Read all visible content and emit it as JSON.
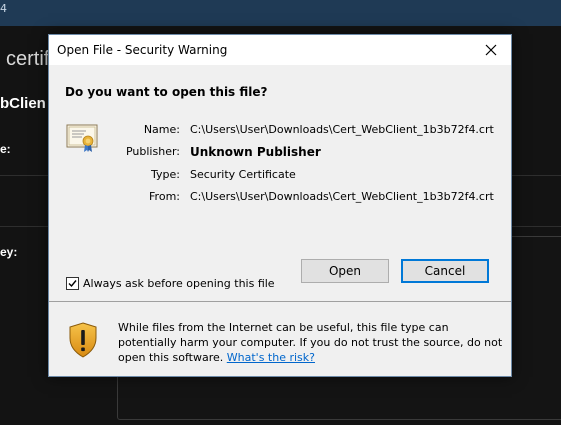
{
  "background_app": {
    "titlebar_text": "4",
    "heading": "certif",
    "name_fragment": "bClien",
    "label_1": "e:",
    "label_2": "ey:"
  },
  "dialog": {
    "title": "Open File - Security Warning",
    "question": "Do you want to open this file?",
    "fields": {
      "name_label": "Name:",
      "name_value": "C:\\Users\\User\\Downloads\\Cert_WebClient_1b3b72f4.crt",
      "publisher_label": "Publisher:",
      "publisher_value": "Unknown Publisher",
      "type_label": "Type:",
      "type_value": "Security Certificate",
      "from_label": "From:",
      "from_value": "C:\\Users\\User\\Downloads\\Cert_WebClient_1b3b72f4.crt"
    },
    "buttons": {
      "open_label": "Open",
      "cancel_label": "Cancel"
    },
    "checkbox": {
      "label": "Always ask before opening this file",
      "checked": true
    },
    "footer": {
      "warning_text": "While files from the Internet can be useful, this file type can potentially harm your computer. If you do not trust the source, do not open this software.",
      "risk_link": "What's the risk?"
    },
    "icons": {
      "file_icon": "certificate-icon",
      "warning_icon": "shield-warning-icon",
      "close_icon": "close-icon",
      "checkbox_icon": "checkmark-icon"
    }
  },
  "colors": {
    "accent": "#0078d7",
    "link": "#0066cc",
    "background_titlebar": "#1f3a55",
    "background": "#131313"
  }
}
